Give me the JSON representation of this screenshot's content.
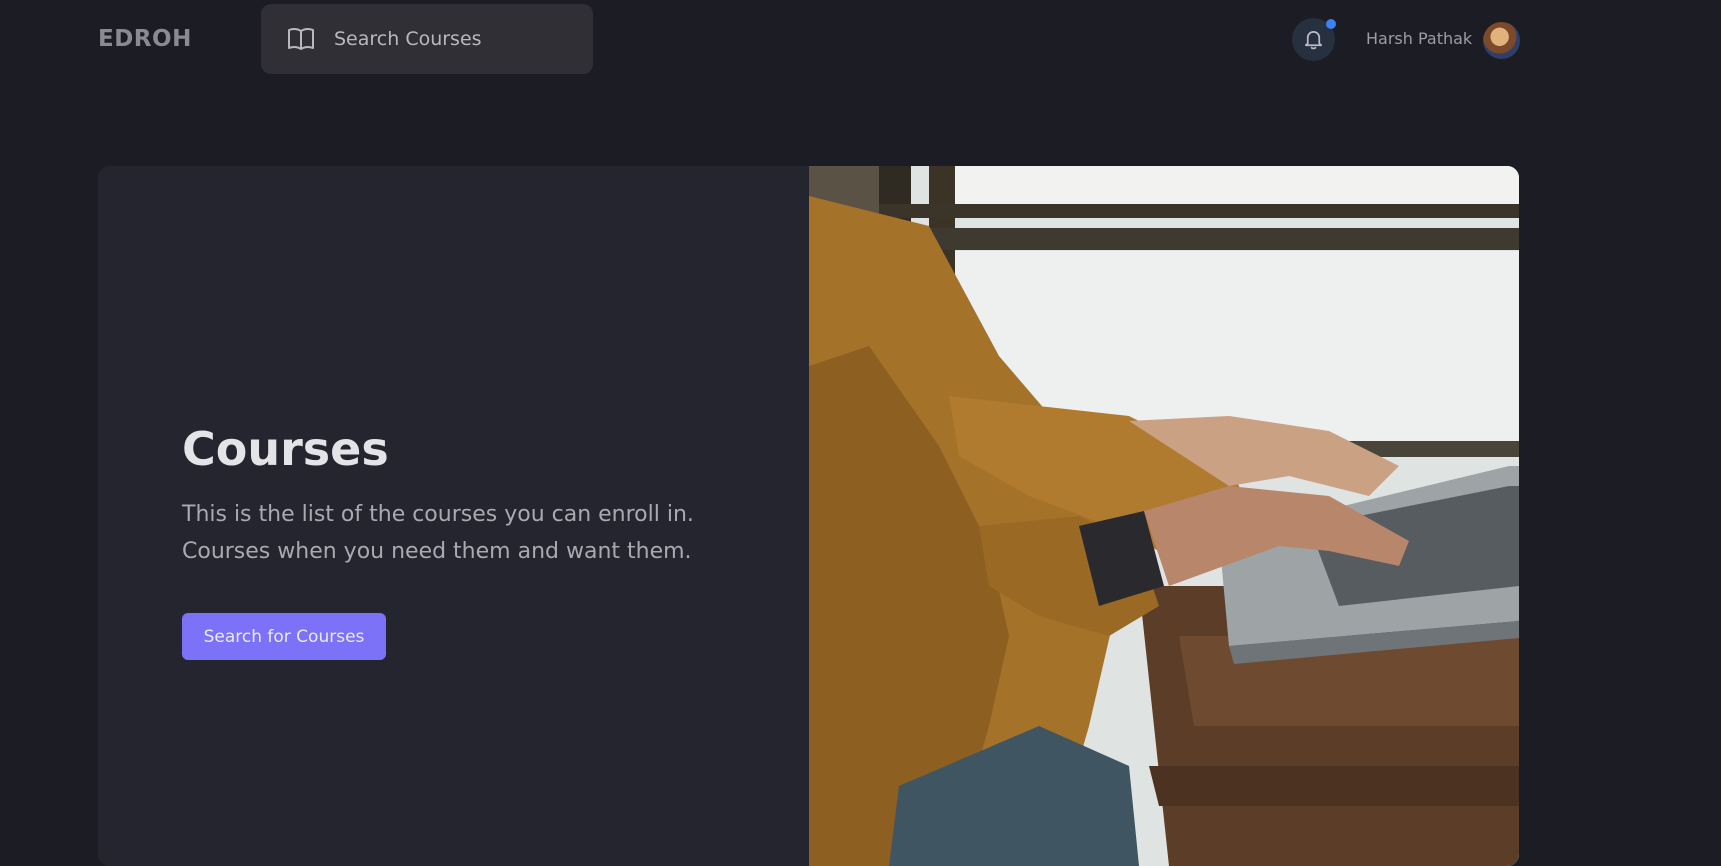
{
  "header": {
    "logo": "EDROH",
    "search": {
      "label": "Search Courses",
      "icon": "book-open-icon"
    },
    "notifications": {
      "icon": "bell-icon",
      "has_unread": true,
      "dot_color": "#3b82f6"
    },
    "user": {
      "name": "Harsh Pathak"
    }
  },
  "hero": {
    "title": "Courses",
    "description": "This is the list of the courses you can enroll in. Courses when you need them and want them.",
    "button_label": "Search for Courses",
    "accent_color": "#7b72f8",
    "image": "person typing on laptop"
  }
}
